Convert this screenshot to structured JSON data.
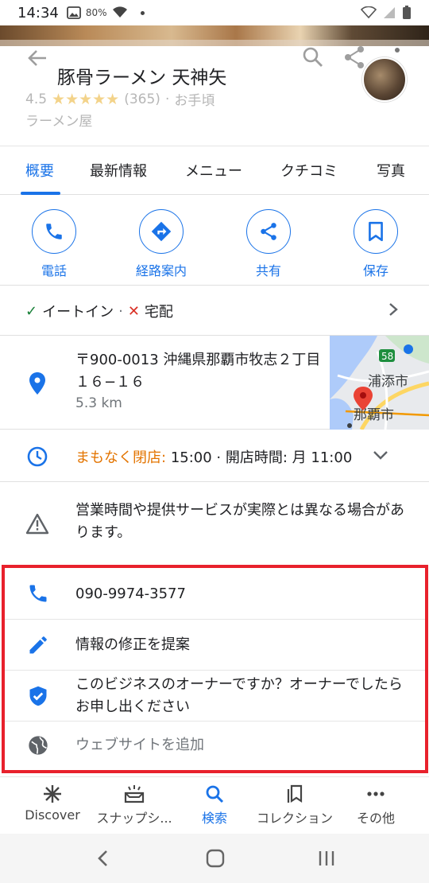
{
  "status_bar": {
    "time": "14:34",
    "battery_percent": "80%"
  },
  "place": {
    "title": "豚骨ラーメン 天神矢",
    "rating": "4.5",
    "stars": "★★★★★",
    "review_count": "(365)",
    "price": "お手頃",
    "category": "ラーメン屋"
  },
  "tabs": [
    {
      "label": "概要",
      "active": true
    },
    {
      "label": "最新情報"
    },
    {
      "label": "メニュー"
    },
    {
      "label": "クチコミ"
    },
    {
      "label": "写真"
    }
  ],
  "actions": [
    {
      "label": "電話",
      "icon": "phone-icon"
    },
    {
      "label": "経路案内",
      "icon": "directions-icon"
    },
    {
      "label": "共有",
      "icon": "share-icon"
    },
    {
      "label": "保存",
      "icon": "bookmark-icon"
    }
  ],
  "services": {
    "dine_in": "イートイン",
    "separator": "·",
    "delivery": "宅配"
  },
  "address": {
    "text": "〒900-0013 沖縄県那覇市牧志２丁目１６−１６",
    "distance": "5.3 km",
    "map_labels": {
      "route": "58",
      "city1": "浦添市",
      "city2": "那覇市"
    }
  },
  "hours": {
    "status": "まもなく閉店:",
    "close_time": "15:00",
    "separator": "·",
    "open_label": "開店時間: 月 11:00"
  },
  "notice": {
    "text": "営業時間や提供サービスが実際とは異なる場合があります。"
  },
  "contact": {
    "phone": "090-9974-3577",
    "suggest_edit": "情報の修正を提案",
    "claim_business": "このビジネスのオーナーですか？オーナーでしたらお申し出ください",
    "add_website": "ウェブサイトを追加"
  },
  "bottom_nav": [
    {
      "label": "Discover",
      "icon": "discover-icon"
    },
    {
      "label": "スナップシ...",
      "icon": "snapshot-icon"
    },
    {
      "label": "検索",
      "icon": "search-icon",
      "active": true
    },
    {
      "label": "コレクション",
      "icon": "collections-icon"
    },
    {
      "label": "その他",
      "icon": "more-icon"
    }
  ],
  "colors": {
    "accent": "#1a73e8",
    "highlight": "#e8212c",
    "closing": "#e37400"
  }
}
